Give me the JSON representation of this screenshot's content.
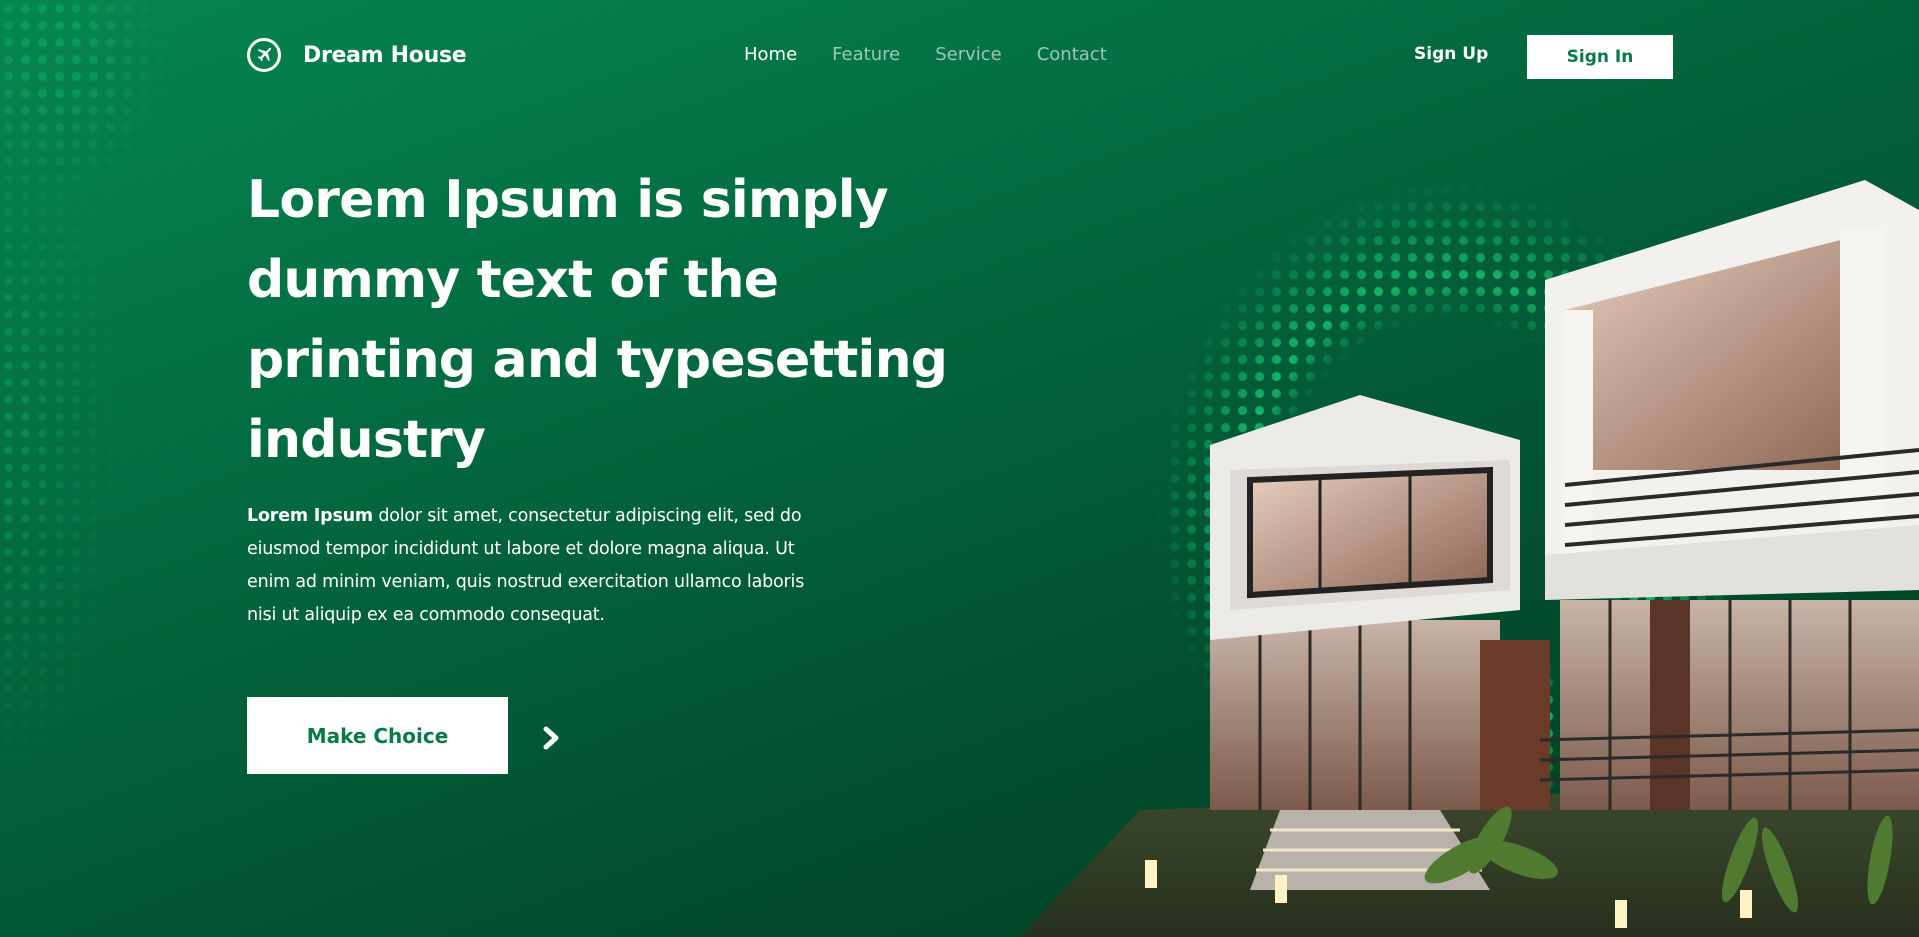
{
  "brand": {
    "name": "Dream House",
    "icon": "airplane-logo-icon"
  },
  "nav": {
    "links": [
      {
        "label": "Home",
        "active": true
      },
      {
        "label": "Feature",
        "active": false
      },
      {
        "label": "Service",
        "active": false
      },
      {
        "label": "Contact",
        "active": false
      }
    ],
    "signup_label": "Sign Up",
    "signin_label": "Sign In"
  },
  "hero": {
    "heading_lines": [
      "Lorem Ipsum is simply",
      "dummy text of the",
      "printing and typesetting",
      "industry"
    ],
    "desc_bold": "Lorem Ipsum",
    "desc_rest": " dolor sit amet, consectetur adipiscing elit, sed do eiusmod tempor incididunt ut labore et dolore magna aliqua. Ut enim ad minim veniam, quis nostrud exercitation ullamco laboris nisi ut aliquip ex ea commodo consequat.",
    "cta_label": "Make Choice",
    "cta_icon": "chevron-right-icon"
  },
  "colors": {
    "brand_green": "#067a47",
    "bg_top": "#05864f",
    "bg_bottom": "#023d25",
    "text": "#ffffff"
  },
  "house_image": {
    "subject": "modern two-storey white house"
  }
}
